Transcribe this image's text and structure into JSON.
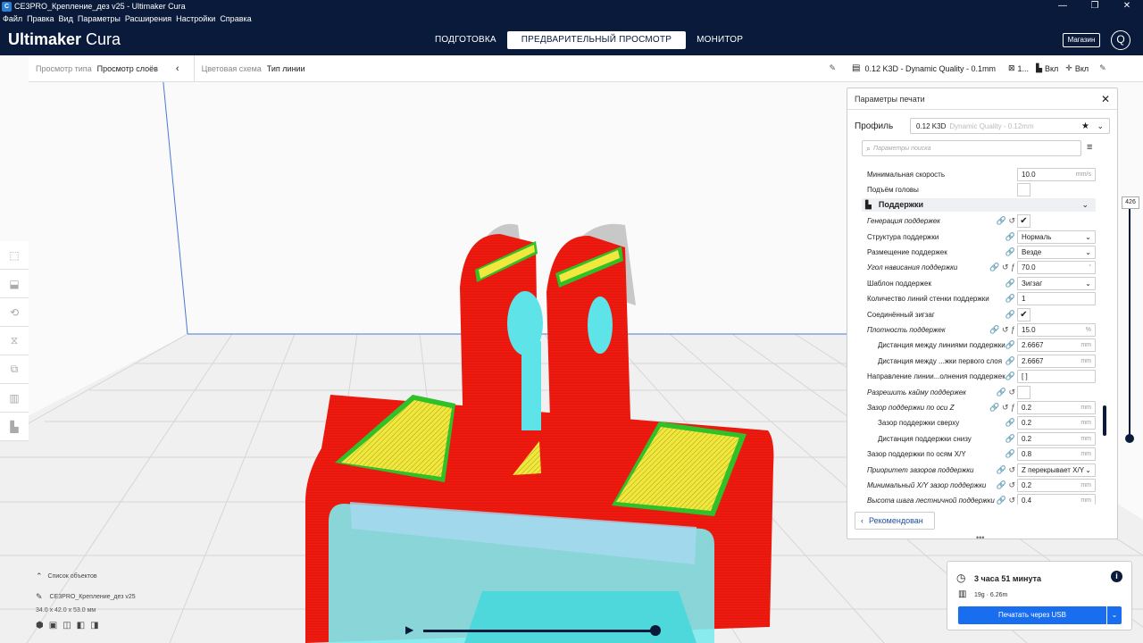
{
  "window": {
    "title": "CE3PRO_Крепление_дез v25 - Ultimaker Cura",
    "menu": [
      "Файл",
      "Правка",
      "Вид",
      "Параметры",
      "Расширения",
      "Настройки",
      "Справка"
    ]
  },
  "header": {
    "logo_bold": "Ultimaker",
    "logo_light": " Cura",
    "stages": [
      {
        "label": "ПОДГОТОВКА",
        "active": false
      },
      {
        "label": "ПРЕДВАРИТЕЛЬНЫЙ ПРОСМОТР",
        "active": true
      },
      {
        "label": "МОНИТОР",
        "active": false
      }
    ],
    "shop_label": "Магазин",
    "account_label": "Q"
  },
  "view_toolbar": {
    "view_type_label": "Просмотр типа",
    "view_type_value": "Просмотр слоёв",
    "color_scheme_label": "Цветовая схема",
    "color_scheme_value": "Тип линии"
  },
  "profile_bar": {
    "profile": "0.12 K3D - Dynamic Quality - 0.1mm",
    "infill": "1...",
    "support": "Вкл",
    "adhesion": "Вкл"
  },
  "settings_panel": {
    "title": "Параметры печати",
    "profile_label": "Профиль",
    "profile_value": "0.12 K3D",
    "profile_sub": "Dynamic Quality - 0.12mm",
    "search_placeholder": "Параметры поиска",
    "recommended_label": "Рекомендован",
    "category": "Поддержки",
    "rows": [
      {
        "name": "Минимальная скорость",
        "type": "text",
        "value": "10.0",
        "unit": "mm/s",
        "indent": false,
        "italic": false,
        "icons": ""
      },
      {
        "name": "Подъём головы",
        "type": "check",
        "value": "",
        "indent": false,
        "italic": false,
        "icons": ""
      },
      {
        "name": "Генерация поддержек",
        "type": "check",
        "value": "✔",
        "indent": false,
        "italic": true,
        "icons": "🔗 ↺"
      },
      {
        "name": "Структура поддержки",
        "type": "select",
        "value": "Нормаль",
        "indent": false,
        "italic": false,
        "icons": "🔗"
      },
      {
        "name": "Размещение поддержек",
        "type": "select",
        "value": "Везде",
        "indent": false,
        "italic": false,
        "icons": "🔗"
      },
      {
        "name": "Угол нависания поддержки",
        "type": "text",
        "value": "70.0",
        "unit": "°",
        "indent": false,
        "italic": true,
        "icons": "🔗 ↺ ƒ"
      },
      {
        "name": "Шаблон поддержек",
        "type": "select",
        "value": "Зигзаг",
        "indent": false,
        "italic": false,
        "icons": "🔗"
      },
      {
        "name": "Количество линий стенки поддержки",
        "type": "text",
        "value": "1",
        "unit": "",
        "indent": false,
        "italic": false,
        "icons": "🔗"
      },
      {
        "name": "Соединённый зигзаг",
        "type": "check",
        "value": "✔",
        "indent": false,
        "italic": false,
        "icons": "🔗"
      },
      {
        "name": "Плотность поддержек",
        "type": "text",
        "value": "15.0",
        "unit": "%",
        "indent": false,
        "italic": true,
        "icons": "🔗 ↺ ƒ"
      },
      {
        "name": "Дистанция между линиями поддержки",
        "type": "text",
        "value": "2.6667",
        "unit": "mm",
        "indent": true,
        "italic": false,
        "icons": "🔗"
      },
      {
        "name": "Дистанция между ...жки первого слоя",
        "type": "text",
        "value": "2.6667",
        "unit": "mm",
        "indent": true,
        "italic": false,
        "icons": "🔗"
      },
      {
        "name": "Направление линии...олнения поддержек",
        "type": "text",
        "value": "[ ]",
        "unit": "",
        "indent": false,
        "italic": false,
        "icons": "🔗"
      },
      {
        "name": "Разрешить кайму поддержек",
        "type": "check",
        "value": "",
        "indent": false,
        "italic": true,
        "icons": "🔗 ↺"
      },
      {
        "name": "Зазор поддержки по оси Z",
        "type": "text",
        "value": "0.2",
        "unit": "mm",
        "indent": false,
        "italic": true,
        "icons": "🔗 ↺ ƒ"
      },
      {
        "name": "Зазор поддержки сверху",
        "type": "text",
        "value": "0.2",
        "unit": "mm",
        "indent": true,
        "italic": false,
        "icons": "🔗"
      },
      {
        "name": "Дистанция поддержки снизу",
        "type": "text",
        "value": "0.2",
        "unit": "mm",
        "indent": true,
        "italic": false,
        "icons": "🔗"
      },
      {
        "name": "Зазор поддержки по осям X/Y",
        "type": "text",
        "value": "0.8",
        "unit": "mm",
        "indent": false,
        "italic": false,
        "icons": "🔗"
      },
      {
        "name": "Приоритет зазоров поддержки",
        "type": "select",
        "value": "Z перекрывает X/Y",
        "indent": false,
        "italic": true,
        "icons": "🔗 ↺"
      },
      {
        "name": "Минимальный X/Y зазор поддержки",
        "type": "text",
        "value": "0.2",
        "unit": "mm",
        "indent": false,
        "italic": true,
        "icons": "🔗 ↺"
      },
      {
        "name": "Высота шага лестничной поддержки",
        "type": "text",
        "value": "0.4",
        "unit": "mm",
        "indent": false,
        "italic": true,
        "icons": "🔗 ↺"
      }
    ]
  },
  "layer_slider": {
    "current_layer": "426"
  },
  "object_list": {
    "header": "Список объектов",
    "object_name": "CE3PRO_Крепление_дез v25",
    "dimensions": "34.0 x 42.0 x 53.0 мм"
  },
  "estimate": {
    "time": "3 часа 51 минута",
    "material": "19g · 6.26m",
    "print_button": "Печатать через USB"
  },
  "colors": {
    "header_bg": "#0a1a3a",
    "accent_blue": "#196ef0",
    "model_red": "#ee1a10",
    "support_cyan": "#5ee4e8",
    "skin_yellow": "#f0e83c",
    "wall_green": "#2fc02a"
  }
}
